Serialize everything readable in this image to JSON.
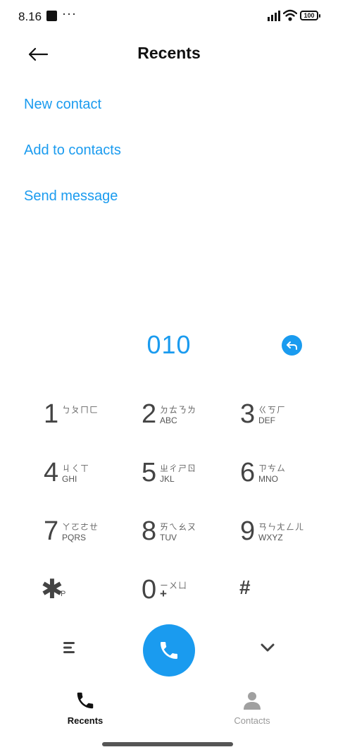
{
  "status_bar": {
    "time": "8.16",
    "more_dots": "···",
    "battery": "100"
  },
  "header": {
    "title": "Recents"
  },
  "actions": [
    {
      "label": "New contact"
    },
    {
      "label": "Add to contacts"
    },
    {
      "label": "Send message"
    }
  ],
  "dial_number": "010",
  "keypad": {
    "keys": [
      {
        "digit": "1",
        "zhuyin": "ㄅㄆㄇㄈ",
        "letters": ""
      },
      {
        "digit": "2",
        "zhuyin": "ㄉㄊㄋㄌ",
        "letters": "ABC"
      },
      {
        "digit": "3",
        "zhuyin": "ㄍㄎㄏ",
        "letters": "DEF"
      },
      {
        "digit": "4",
        "zhuyin": "ㄐㄑㄒ",
        "letters": "GHI"
      },
      {
        "digit": "5",
        "zhuyin": "ㄓㄔㄕㄖ",
        "letters": "JKL"
      },
      {
        "digit": "6",
        "zhuyin": "ㄗㄘㄙ",
        "letters": "MNO"
      },
      {
        "digit": "7",
        "zhuyin": "ㄚㄛㄜㄝ",
        "letters": "PQRS"
      },
      {
        "digit": "8",
        "zhuyin": "ㄞㄟㄠㄡ",
        "letters": "TUV"
      },
      {
        "digit": "9",
        "zhuyin": "ㄢㄣㄤㄥㄦ",
        "letters": "WXYZ"
      },
      {
        "digit": "0",
        "zhuyin": "ㄧㄨㄩ",
        "letters": "+"
      }
    ],
    "star": {
      "symbol": "✱",
      "sub": "P"
    },
    "hash": {
      "symbol": "#"
    }
  },
  "bottom_nav": {
    "recents_label": "Recents",
    "contacts_label": "Contacts"
  },
  "icons": {
    "back": "back-arrow-icon",
    "backspace": "backspace-icon",
    "call": "phone-icon",
    "menu": "menu-icon",
    "collapse": "chevron-down-icon",
    "recents": "phone-icon",
    "contacts": "person-icon"
  },
  "colors": {
    "accent": "#1a9bef",
    "text": "#111111",
    "muted": "#999999"
  }
}
